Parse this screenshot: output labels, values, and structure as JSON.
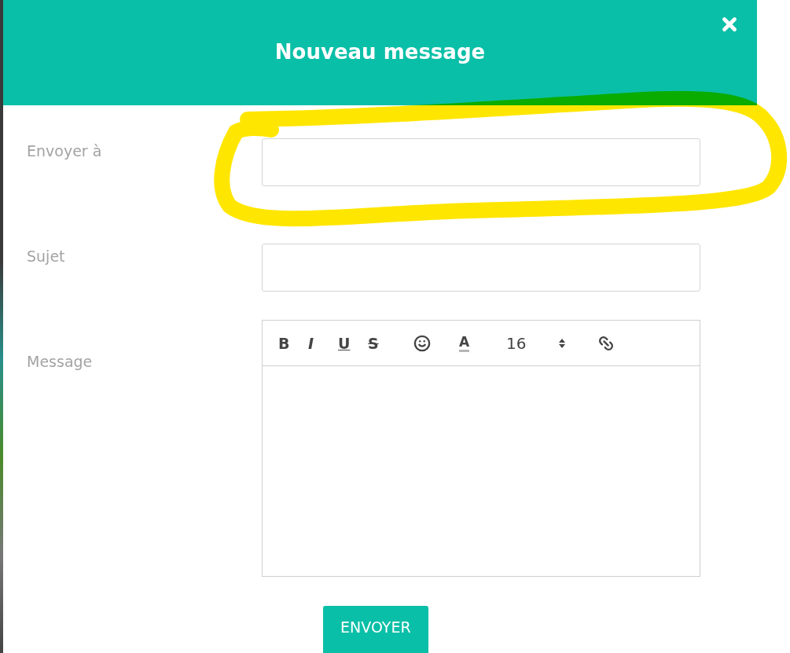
{
  "dialog": {
    "title": "Nouveau message"
  },
  "fields": [
    {
      "kind": "input",
      "label": "Envoyer à"
    },
    {
      "kind": "input",
      "label": "Sujet"
    },
    {
      "kind": "editor",
      "label": "Message"
    }
  ],
  "toolbar": [
    {
      "kind": "bold",
      "label": "B"
    },
    {
      "kind": "italic",
      "label": "I"
    },
    {
      "kind": "underline",
      "label": "U"
    },
    {
      "kind": "strike",
      "label": "S"
    },
    {
      "kind": "emoji"
    },
    {
      "kind": "color",
      "label": "A"
    },
    {
      "kind": "size",
      "label": "16"
    },
    {
      "kind": "stepper"
    },
    {
      "kind": "link"
    }
  ],
  "submit": {
    "label": "ENVOYER"
  },
  "annotation": {
    "kind": "highlight"
  }
}
